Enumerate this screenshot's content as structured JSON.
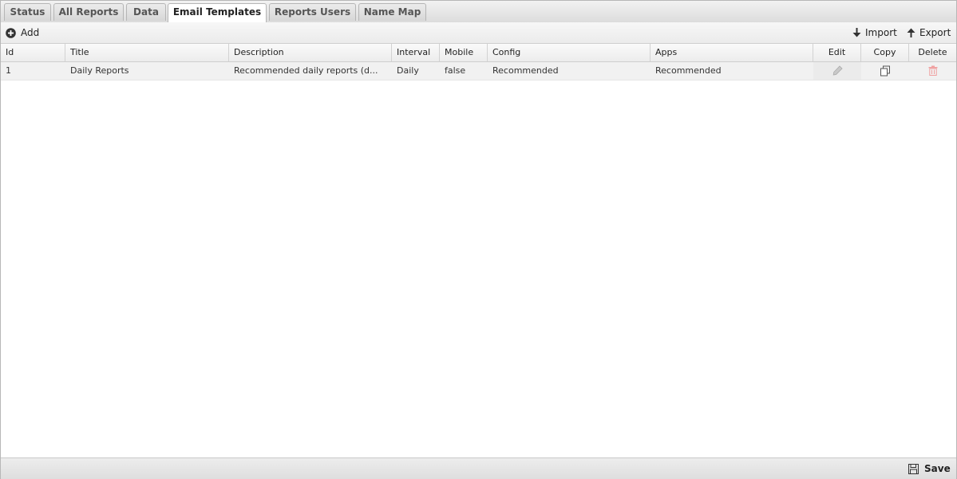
{
  "tabs": [
    {
      "label": "Status"
    },
    {
      "label": "All Reports"
    },
    {
      "label": "Data"
    },
    {
      "label": "Email Templates"
    },
    {
      "label": "Reports Users"
    },
    {
      "label": "Name Map"
    }
  ],
  "toolbar": {
    "add_label": "Add",
    "import_label": "Import",
    "export_label": "Export"
  },
  "grid": {
    "columns": [
      "Id",
      "Title",
      "Description",
      "Interval",
      "Mobile",
      "Config",
      "Apps",
      "Edit",
      "Copy",
      "Delete"
    ],
    "rows": [
      {
        "id": "1",
        "title": "Daily Reports",
        "description": "Recommended daily reports (d...",
        "interval": "Daily",
        "mobile": "false",
        "config": "Recommended",
        "apps": "Recommended"
      }
    ]
  },
  "footer": {
    "save_label": "Save"
  },
  "icons": {
    "add": "plus-circle-icon",
    "import": "arrow-down-icon",
    "export": "arrow-up-icon",
    "edit": "pencil-icon",
    "copy": "copy-icon",
    "delete": "trash-icon",
    "save": "floppy-disk-icon"
  },
  "colors": {
    "delete_icon": "#f0a0a0",
    "muted_icon": "#999999"
  }
}
